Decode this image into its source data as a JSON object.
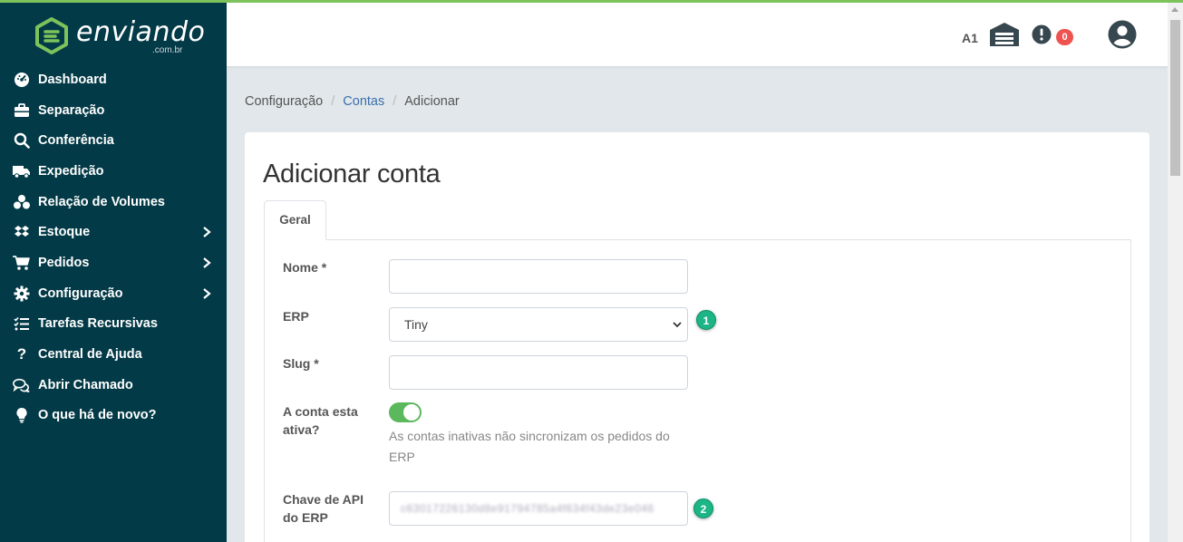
{
  "brand": {
    "name": "enviando",
    "suffix": ".com.br"
  },
  "sidebar": {
    "items": [
      {
        "label": "Dashboard",
        "icon": "dashboard-gauge-icon",
        "submenu": false
      },
      {
        "label": "Separação",
        "icon": "briefcase-icon",
        "submenu": false
      },
      {
        "label": "Conferência",
        "icon": "search-icon",
        "submenu": false
      },
      {
        "label": "Expedição",
        "icon": "truck-icon",
        "submenu": false
      },
      {
        "label": "Relação de Volumes",
        "icon": "boxes-icon",
        "submenu": false
      },
      {
        "label": "Estoque",
        "icon": "dropbox-icon",
        "submenu": true
      },
      {
        "label": "Pedidos",
        "icon": "cart-icon",
        "submenu": true
      },
      {
        "label": "Configuração",
        "icon": "gear-icon",
        "submenu": true
      },
      {
        "label": "Tarefas Recursivas",
        "icon": "tasks-icon",
        "submenu": false
      },
      {
        "label": "Central de Ajuda",
        "icon": "question-icon",
        "submenu": false
      },
      {
        "label": "Abrir Chamado",
        "icon": "comments-icon",
        "submenu": false
      },
      {
        "label": "O que há de novo?",
        "icon": "lightbulb-icon",
        "submenu": false
      }
    ]
  },
  "header": {
    "warehouse_code": "A1",
    "notification_count": "0"
  },
  "breadcrumb": {
    "items": [
      "Configuração",
      "Contas",
      "Adicionar"
    ]
  },
  "page": {
    "title": "Adicionar conta"
  },
  "tabs": [
    {
      "label": "Geral",
      "active": true
    }
  ],
  "form": {
    "nome": {
      "label": "Nome *",
      "value": ""
    },
    "erp": {
      "label": "ERP",
      "selected": "Tiny",
      "hint": "1"
    },
    "slug": {
      "label": "Slug *",
      "value": ""
    },
    "ativa": {
      "label_line1": "A conta esta",
      "label_line2": "ativa?",
      "on": true,
      "help": "As contas inativas não sincronizam os pedidos do ERP"
    },
    "api_key": {
      "label_line1": "Chave de API",
      "label_line2": "do ERP",
      "value": "c63017226130d8e91794785a4f634f43de23e046",
      "hint": "2"
    }
  },
  "colors": {
    "sidebar": "#033a47",
    "accent": "#7dc35b",
    "badge": "#ef5350",
    "hint": "#1cb585",
    "toggle": "#5cb85c",
    "link": "#3c6fae"
  }
}
